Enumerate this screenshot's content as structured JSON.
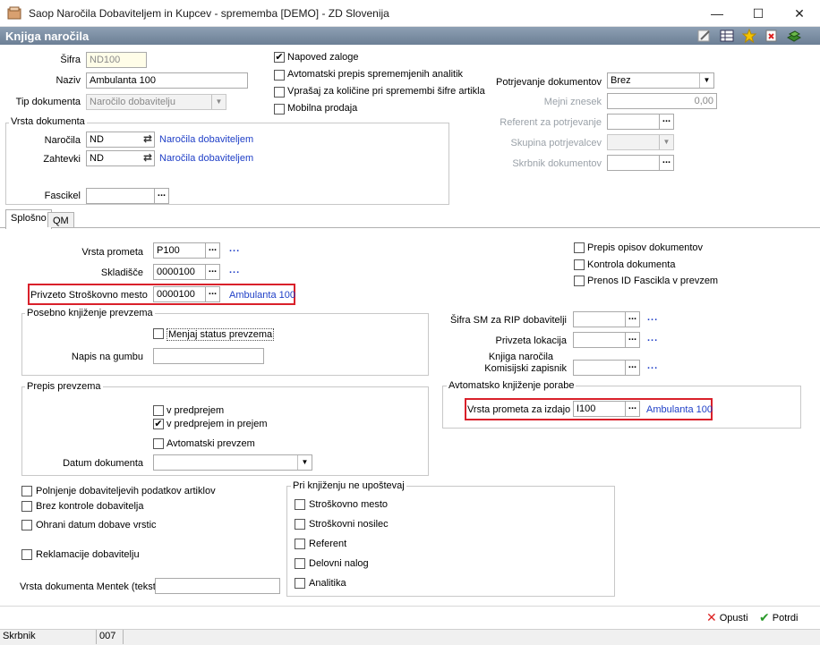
{
  "window": {
    "title": "Saop Naročila Dobaviteljem in Kupcev - sprememba [DEMO] - ZD Slovenija",
    "minimize": "—",
    "maximize": "☐",
    "close": "✕"
  },
  "header": {
    "title": "Knjiga naročila"
  },
  "top": {
    "sifra_label": "Šifra",
    "sifra_value": "ND100",
    "naziv_label": "Naziv",
    "naziv_value": "Ambulanta 100",
    "tip_label": "Tip dokumenta",
    "tip_value": "Naročilo dobavitelju",
    "checks": [
      {
        "label": "Napoved zaloge",
        "checked": true
      },
      {
        "label": "Avtomatski prepis sprememjenih analitik",
        "checked": false
      },
      {
        "label": "Vprašaj za količine pri spremembi šifre artikla",
        "checked": false
      },
      {
        "label": "Mobilna prodaja",
        "checked": false
      }
    ],
    "vrsta_group_title": "Vrsta dokumenta",
    "narocila_label": "Naročila",
    "narocila_value": "ND",
    "narocila_link": "Naročila dobaviteljem",
    "zahtevki_label": "Zahtevki",
    "zahtevki_value": "ND",
    "zahtevki_link": "Naročila dobaviteljem",
    "fascikel_label": "Fascikel",
    "potrjevanje_label": "Potrjevanje dokumentov",
    "potrjevanje_value": "Brez",
    "mejni_label": "Mejni znesek",
    "mejni_value": "0,00",
    "referent_label": "Referent za potrjevanje",
    "skupina_label": "Skupina potrjevalcev",
    "skrbnik_label": "Skrbnik dokumentov",
    "dots": "..."
  },
  "tabs": [
    {
      "label": "Splošno"
    },
    {
      "label": "QM"
    }
  ],
  "splosno": {
    "vrsta_prometa_label": "Vrsta prometa",
    "vrsta_prometa_value": "P100",
    "skladisce_label": "Skladišče",
    "skladisce_value": "0000100",
    "privzeto_sm_label": "Privzeto Stroškovno mesto",
    "privzeto_sm_value": "0000100",
    "privzeto_sm_link": "Ambulanta 100",
    "link_dots": "...",
    "posebno_title": "Posebno knjiženje prevzema",
    "menjaj_label": "Menjaj status prevzema",
    "napis_label": "Napis na gumbu",
    "prepis_title": "Prepis prevzema",
    "v_predprejem": "v predprejem",
    "v_predprejem_prejem": "v predprejem in prejem",
    "avt_prevzem": "Avtomatski prevzem",
    "datum_label": "Datum dokumenta",
    "right_checks": [
      "Prepis opisov dokumentov",
      "Kontrola dokumenta",
      "Prenos ID Fascikla v prevzem"
    ],
    "sifra_sm_label": "Šifra SM za RIP dobavitelji",
    "privzeta_lok_label": "Privzeta lokacija",
    "knjiga_narocila_label": "Knjiga naročila",
    "komisijski_label": "Komisijski zapisnik",
    "avt_knjizenje_title": "Avtomatsko knjiženje porabe",
    "vrsta_izdajo_label": "Vrsta prometa za izdajo",
    "vrsta_izdajo_value": "I100",
    "vrsta_izdajo_link": "Ambulanta 100",
    "bottom_checks": [
      "Polnjenje dobaviteljevih podatkov artiklov",
      "Brez kontrole dobavitelja",
      "Ohrani datum dobave vrstic"
    ],
    "reklamacije": "Reklamacije dobavitelju",
    "mentek_label": "Vrsta dokumenta Mentek (tekst)",
    "pri_knjizenju_title": "Pri knjiženju ne upoštevaj",
    "pri_checks": [
      "Stroškovno mesto",
      "Stroškovni nosilec",
      "Referent",
      "Delovni nalog",
      "Analitika"
    ]
  },
  "buttons": {
    "cancel": "Opusti",
    "confirm": "Potrdi"
  },
  "status": {
    "label": "Skrbnik",
    "value": "007"
  }
}
